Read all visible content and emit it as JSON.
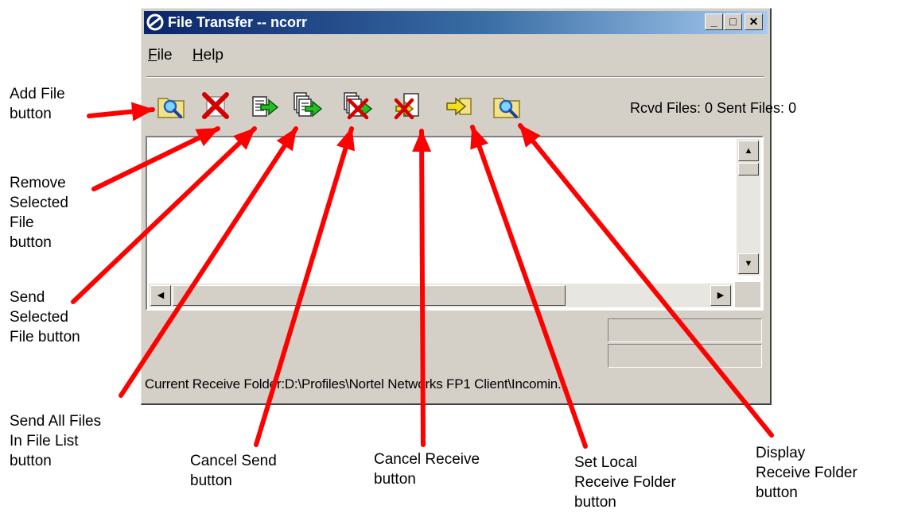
{
  "window": {
    "title": "File Transfer -- ncorr",
    "controls": {
      "minimize": "_",
      "maximize": "□",
      "close": "✕"
    }
  },
  "menu": [
    {
      "first": "F",
      "rest": "ile"
    },
    {
      "first": "H",
      "rest": "elp"
    }
  ],
  "toolbar": {
    "status_counts": "Rcvd Files: 0  Sent Files: 0",
    "buttons": [
      {
        "name": "add-file-button",
        "icon": "folder-magnifier-icon"
      },
      {
        "name": "remove-selected-file-button",
        "icon": "red-x-icon"
      },
      {
        "name": "send-selected-file-button",
        "icon": "document-green-arrow-icon"
      },
      {
        "name": "send-all-files-button",
        "icon": "documents-green-arrow-icon"
      },
      {
        "name": "cancel-send-button",
        "icon": "documents-arrow-red-x-icon"
      },
      {
        "name": "cancel-receive-button",
        "icon": "document-red-x-icon"
      },
      {
        "name": "set-local-receive-folder-button",
        "icon": "yellow-arrow-folder-icon"
      },
      {
        "name": "display-receive-folder-button",
        "icon": "folder-magnifier-icon"
      }
    ]
  },
  "status_bar": {
    "receive_folder": "Current Receive Folder:D:\\Profiles\\Nortel Networks FP1 Client\\Incomin..."
  },
  "callouts": {
    "add_file": "Add File\nbutton",
    "remove_selected": "Remove\nSelected\nFile\nbutton",
    "send_selected": "Send\nSelected\nFile button",
    "send_all": "Send All Files\nIn File List\nbutton",
    "cancel_send": "Cancel Send\nbutton",
    "cancel_receive": "Cancel Receive\nbutton",
    "set_local": "Set Local\nReceive Folder\nbutton",
    "display_receive": "Display\nReceive Folder\nbutton"
  },
  "colors": {
    "title_gradient_start": "#0a246a",
    "title_gradient_end": "#a6caf0",
    "window_face": "#d4d0c8",
    "arrow_red": "#ff0000"
  }
}
